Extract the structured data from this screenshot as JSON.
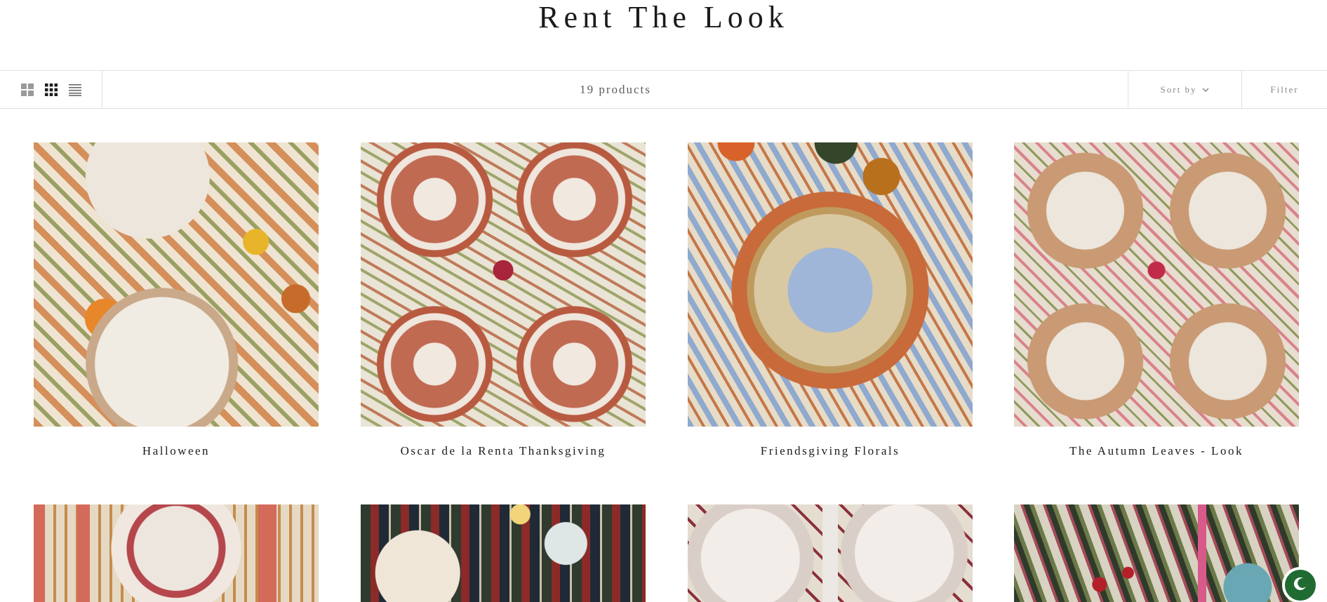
{
  "page": {
    "title": "Rent The Look"
  },
  "toolbar": {
    "layout_options": [
      "grid-large-icon",
      "grid-small-icon",
      "list-icon"
    ],
    "product_count": "19 products",
    "sort_label": "Sort by",
    "filter_label": "Filter"
  },
  "products": [
    {
      "name": "Halloween"
    },
    {
      "name": "Oscar de la Renta Thanksgiving"
    },
    {
      "name": "Friendsgiving Florals"
    },
    {
      "name": "The Autumn Leaves - Look"
    },
    {
      "name": ""
    },
    {
      "name": ""
    },
    {
      "name": ""
    },
    {
      "name": ""
    }
  ],
  "colors": {
    "text": "#1c1b1b",
    "border": "#e1e1e1",
    "muted": "#8a8a8a",
    "chat_widget": "#1f6b32"
  }
}
